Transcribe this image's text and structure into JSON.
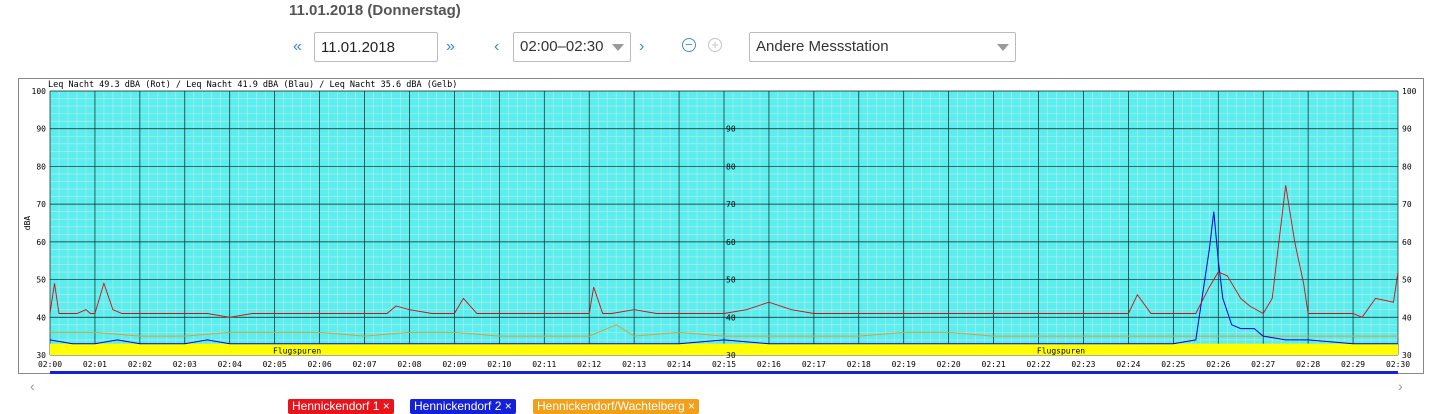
{
  "header": {
    "title": "11.01.2018 (Donnerstag)"
  },
  "controls": {
    "prev_day": "«",
    "next_day": "»",
    "date_value": "11.01.2018",
    "prev_slot": "‹",
    "next_slot": "›",
    "time_slot": "02:00–02:30",
    "zoom_out_icon": "minus-circle-icon",
    "zoom_in_icon": "plus-circle-icon",
    "station": "Andere Messstation"
  },
  "chips": [
    {
      "label": "Hennickendorf 1 ×",
      "color": "#e8141b"
    },
    {
      "label": "Hennickendorf 2 ×",
      "color": "#1421d8"
    },
    {
      "label": "Hennickendorf/Wachtelberg ×",
      "color": "#f2a01a"
    }
  ],
  "scroll": {
    "left": "‹",
    "right": "›"
  },
  "colors": {
    "plot_bg": "#5beeee",
    "red": "#cc1111",
    "blue": "#0000dd",
    "gold": "#d4a23a",
    "band": "#ffff00"
  },
  "chart_data": {
    "type": "line",
    "title": "Leq Nacht 49.3 dBA (Rot) / Leq Nacht 41.9 dBA (Blau) / Leq Nacht 35.6 dBA (Gelb)",
    "ylabel": "dBA",
    "xlabel": "",
    "ylim": [
      30,
      100
    ],
    "yticks": [
      30,
      40,
      50,
      60,
      70,
      80,
      90,
      100
    ],
    "inner_yticks": [
      30,
      40,
      50,
      60,
      70,
      80,
      90
    ],
    "xlim": [
      0,
      30
    ],
    "xticks": [
      "02:00",
      "02:01",
      "02:02",
      "02:03",
      "02:04",
      "02:05",
      "02:06",
      "02:07",
      "02:08",
      "02:09",
      "02:10",
      "02:11",
      "02:12",
      "02:13",
      "02:14",
      "02:15",
      "02:16",
      "02:17",
      "02:18",
      "02:19",
      "02:20",
      "02:21",
      "02:22",
      "02:23",
      "02:24",
      "02:25",
      "02:26",
      "02:27",
      "02:28",
      "02:29",
      "02:30"
    ],
    "grid": true,
    "band": {
      "label": "Flugspuren",
      "label_positions": [
        5.5,
        22.5
      ],
      "ymin": 30,
      "ymax": 33
    },
    "series": [
      {
        "name": "Rot",
        "x": [
          0,
          0.1,
          0.2,
          0.4,
          0.6,
          0.8,
          0.9,
          1.0,
          1.2,
          1.4,
          1.6,
          2,
          2.5,
          3,
          3.5,
          4,
          4.5,
          5,
          5.5,
          6,
          6.5,
          7,
          7.5,
          7.7,
          8,
          8.5,
          9,
          9.2,
          9.5,
          10,
          10.5,
          11,
          11.5,
          12,
          12.1,
          12.3,
          12.5,
          13,
          13.5,
          14,
          14.5,
          15,
          15.5,
          16,
          16.5,
          17,
          17.5,
          18,
          18.5,
          19,
          19.5,
          20,
          20.5,
          21,
          21.5,
          22,
          22.5,
          23,
          23.5,
          24,
          24.2,
          24.5,
          25,
          25.5,
          25.8,
          26,
          26.2,
          26.5,
          26.7,
          27,
          27.2,
          27.35,
          27.5,
          27.7,
          27.9,
          28,
          28.5,
          29,
          29.2,
          29.5,
          29.9,
          30
        ],
        "values": [
          41,
          49,
          41,
          41,
          41,
          42,
          41,
          41,
          49,
          42,
          41,
          41,
          41,
          41,
          41,
          40,
          41,
          41,
          41,
          41,
          41,
          41,
          41,
          43,
          42,
          41,
          41,
          45,
          41,
          41,
          41,
          41,
          41,
          41,
          48,
          41,
          41,
          42,
          41,
          41,
          41,
          41,
          42,
          44,
          42,
          41,
          41,
          41,
          41,
          41,
          41,
          41,
          41,
          41,
          41,
          41,
          41,
          41,
          41,
          41,
          46,
          41,
          41,
          41,
          48,
          52,
          51,
          45,
          43,
          41,
          45,
          60,
          75,
          60,
          49,
          41,
          41,
          41,
          40,
          45,
          44,
          52
        ]
      },
      {
        "name": "Blau",
        "x": [
          0,
          0.5,
          1,
          1.5,
          2,
          2.5,
          3,
          3.5,
          4,
          5,
          6,
          7,
          8,
          9,
          10,
          11,
          12,
          13,
          14,
          15,
          16,
          17,
          18,
          19,
          20,
          21,
          22,
          23,
          24,
          25,
          25.5,
          25.8,
          25.9,
          26,
          26.1,
          26.3,
          26.5,
          26.8,
          27,
          27.5,
          28,
          29,
          30
        ],
        "values": [
          34,
          33,
          33,
          34,
          33,
          33,
          33,
          34,
          33,
          33,
          33,
          33,
          33,
          33,
          33,
          33,
          33,
          33,
          33,
          34,
          33,
          33,
          33,
          33,
          33,
          33,
          33,
          33,
          33,
          33,
          34,
          58,
          68,
          55,
          45,
          38,
          37,
          37,
          35,
          34,
          34,
          33,
          33
        ]
      },
      {
        "name": "Gelb",
        "x": [
          0,
          1,
          2,
          3,
          4,
          5,
          6,
          7,
          8,
          9,
          10,
          11,
          12,
          12.6,
          13,
          14,
          15,
          16,
          17,
          18,
          19,
          20,
          21,
          22,
          23,
          24,
          25,
          26,
          27,
          28,
          29,
          30
        ],
        "values": [
          36,
          36,
          35,
          35,
          36,
          36,
          36,
          35,
          36,
          36,
          35,
          35,
          35,
          38,
          35,
          36,
          35,
          35,
          35,
          35,
          36,
          36,
          35,
          35,
          35,
          35,
          35,
          35,
          35,
          35,
          35,
          35
        ]
      }
    ]
  }
}
